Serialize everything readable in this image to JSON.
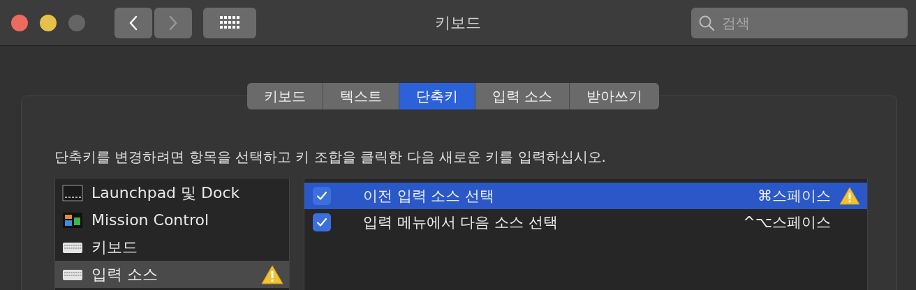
{
  "window": {
    "title": "키보드"
  },
  "search": {
    "placeholder": "검색"
  },
  "tabs": [
    {
      "label": "키보드",
      "selected": false
    },
    {
      "label": "텍스트",
      "selected": false
    },
    {
      "label": "단축키",
      "selected": true
    },
    {
      "label": "입력 소스",
      "selected": false
    },
    {
      "label": "받아쓰기",
      "selected": false
    }
  ],
  "instruction": "단축키를 변경하려면 항목을 선택하고 키 조합을 클릭한 다음 새로운 키를 입력하십시오.",
  "categories": [
    {
      "kind": "dock",
      "label": "Launchpad 및 Dock",
      "selected": false,
      "warning": false
    },
    {
      "kind": "mission",
      "label": "Mission Control",
      "selected": false,
      "warning": false
    },
    {
      "kind": "keyboard",
      "label": "키보드",
      "selected": false,
      "warning": false
    },
    {
      "kind": "keyboard",
      "label": "입력 소스",
      "selected": true,
      "warning": true
    }
  ],
  "shortcuts": [
    {
      "label": "이전 입력 소스 선택",
      "keys": "⌘스페이스",
      "checked": true,
      "selected": true,
      "warning": true
    },
    {
      "label": "입력 메뉴에서 다음 소스 선택",
      "keys": "^⌥스페이스",
      "checked": true,
      "selected": false,
      "warning": false
    }
  ]
}
